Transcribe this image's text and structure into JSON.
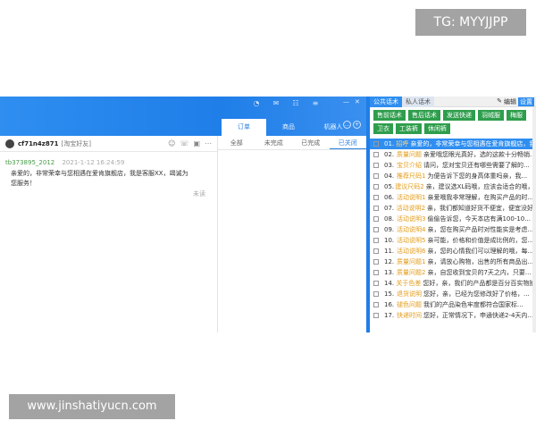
{
  "watermarks": {
    "top": "TG: MYYJJPP",
    "bottom": "www.jinshatiyucn.com"
  },
  "window": {
    "top_tabs": [
      {
        "label": "订单"
      },
      {
        "label": "商品"
      },
      {
        "label": "机器人"
      }
    ]
  },
  "chat": {
    "username": "cf71n4z871",
    "user_tag": "[淘宝好友]",
    "message": {
      "sender": "tb373895_2012",
      "time": "2021-1-12 16:24:59",
      "text": "亲爱的，非常荣幸与您相遇在爱肯旗舰店，我是客服XX，竭诚为您服务！",
      "status": "未读"
    }
  },
  "orders": {
    "tabs": [
      {
        "label": "全部"
      },
      {
        "label": "未完成"
      },
      {
        "label": "已完成"
      },
      {
        "label": "已关闭"
      }
    ]
  },
  "quick_reply": {
    "tabs": [
      {
        "label": "公共话术"
      },
      {
        "label": "私人话术"
      }
    ],
    "edit_label": "编辑",
    "settings_label": "设置",
    "categories": [
      "售前话术",
      "售后话术",
      "发送快递",
      "羽绒服",
      "梅服",
      "卫衣",
      "工装裤",
      "休闲裤"
    ],
    "items": [
      {
        "num": "01.",
        "key": "招呼",
        "text": "亲爱的，非常荣幸与您相遇在爱肯旗舰店，我..."
      },
      {
        "num": "02.",
        "key": "质量问题",
        "text": "亲爱哦您眼光真好，选的这款十分畅销..."
      },
      {
        "num": "03.",
        "key": "宝贝介绍",
        "text": "请问，您对宝贝还有哪些需要了解的..."
      },
      {
        "num": "04.",
        "key": "推荐尺码1",
        "text": "为便告诉下您的身高体重吗亲，我..."
      },
      {
        "num": "05.",
        "key": "建议尺码2",
        "text": "亲，建议选XL码哦，应该会适合的哦，这一..."
      },
      {
        "num": "06.",
        "key": "活动说明1",
        "text": "亲爱哦我非常理解，在购买产品的时..."
      },
      {
        "num": "07.",
        "key": "活动说明2",
        "text": "亲，我们都知道好货不便宜，便宜没好..."
      },
      {
        "num": "08.",
        "key": "活动说明3",
        "text": "偷偷告诉您，今天本店有满100-10..."
      },
      {
        "num": "09.",
        "key": "活动说明4",
        "text": "亲，您在购买产品时对性能实是考虑..."
      },
      {
        "num": "10.",
        "key": "活动说明5",
        "text": "亲可能，价格和价值是成比例的，您..."
      },
      {
        "num": "11.",
        "key": "活动说明6",
        "text": "亲，您的心情我们可以理解的哦，每..."
      },
      {
        "num": "12.",
        "key": "质量问题1",
        "text": "亲，请放心购物，出售的所有商品出..."
      },
      {
        "num": "13.",
        "key": "质量问题2",
        "text": "亲，自您收到宝贝的7天之内，只要..."
      },
      {
        "num": "14.",
        "key": "关于色差",
        "text": "您好，亲，我们的产品都是百分百实物拍..."
      },
      {
        "num": "15.",
        "key": "退货说明",
        "text": "您好，亲，已经为您修改好了价格，..."
      },
      {
        "num": "16.",
        "key": "褪色问题",
        "text": "我们的产品染色牢度都符合国家标..."
      },
      {
        "num": "17.",
        "key": "快递时间",
        "text": "您好，正常情况下，申通快递2-4天内..."
      }
    ]
  }
}
